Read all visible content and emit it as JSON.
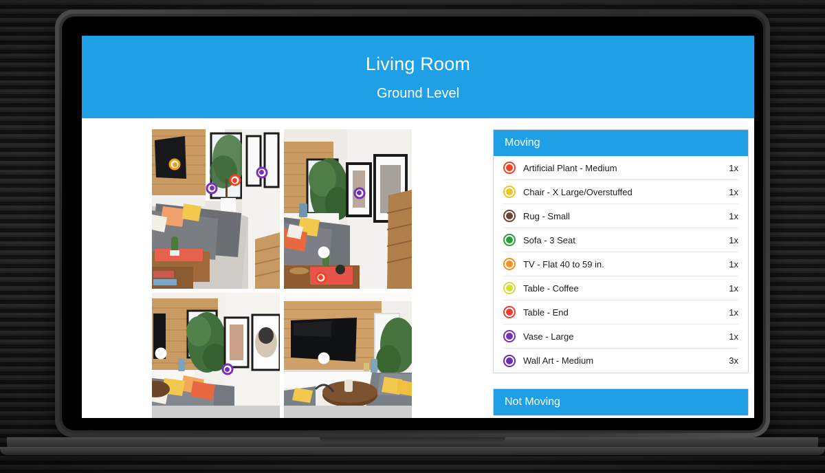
{
  "header": {
    "title": "Living Room",
    "subtitle": "Ground Level",
    "background_color": "#1f9fe5"
  },
  "photos": [
    {
      "name": "living-room-wide-view",
      "markers": [
        {
          "label": "TV - Flat 40 to 59 in.",
          "color": "#f59b0b",
          "x": 18,
          "y": 22
        },
        {
          "label": "Artificial Plant - Medium",
          "color": "#ef4123",
          "x": 65,
          "y": 32
        },
        {
          "label": "Vase - Large",
          "color": "#7b2fb5",
          "x": 47,
          "y": 37
        },
        {
          "label": "Wall Art - Medium",
          "color": "#7b2fb5",
          "x": 86,
          "y": 27
        }
      ]
    },
    {
      "name": "living-room-hallway-view",
      "markers": [
        {
          "label": "Wall Art - Medium",
          "color": "#7b2fb5",
          "x": 59,
          "y": 40
        },
        {
          "label": "Sofa - 3 Seat",
          "color": "#f2f2f2",
          "x": 31,
          "y": 77
        },
        {
          "label": "Table - End",
          "color": "#ef4123",
          "x": 29,
          "y": 93
        }
      ]
    },
    {
      "name": "living-room-gallery-wall-view",
      "markers": [
        {
          "label": "TV - Flat 40 to 59 in.",
          "color": "#f2f2f2",
          "x": 7,
          "y": 38
        },
        {
          "label": "Wall Art - Medium",
          "color": "#7b2fb5",
          "x": 59,
          "y": 48
        },
        {
          "label": "Sofa - 3 Seat",
          "color": "#27a03c",
          "x": 48,
          "y": 91
        }
      ]
    },
    {
      "name": "living-room-tv-wall-view",
      "markers": [
        {
          "label": "TV - Flat 40 to 59 in.",
          "color": "#f2f2f2",
          "x": 31,
          "y": 41
        },
        {
          "label": "Table - Coffee",
          "color": "#d7dd3c",
          "x": 56,
          "y": 91
        }
      ]
    }
  ],
  "panels": [
    {
      "title": "Moving",
      "items": [
        {
          "label": "Artificial Plant - Medium",
          "qty": "1x",
          "color": "#ef4123"
        },
        {
          "label": "Chair - X Large/Overstuffed",
          "qty": "1x",
          "color": "#f2c422"
        },
        {
          "label": "Rug - Small",
          "qty": "1x",
          "color": "#6b4332"
        },
        {
          "label": "Sofa - 3 Seat",
          "qty": "1x",
          "color": "#27a03c"
        },
        {
          "label": "TV - Flat 40 to 59 in.",
          "qty": "1x",
          "color": "#f7901e"
        },
        {
          "label": "Table - Coffee",
          "qty": "1x",
          "color": "#d7dd3c"
        },
        {
          "label": "Table - End",
          "qty": "1x",
          "color": "#f23b30"
        },
        {
          "label": "Vase - Large",
          "qty": "1x",
          "color": "#7b2fb5"
        },
        {
          "label": "Wall Art - Medium",
          "qty": "3x",
          "color": "#6a2cb0"
        }
      ]
    },
    {
      "title": "Not Moving",
      "items": []
    }
  ]
}
